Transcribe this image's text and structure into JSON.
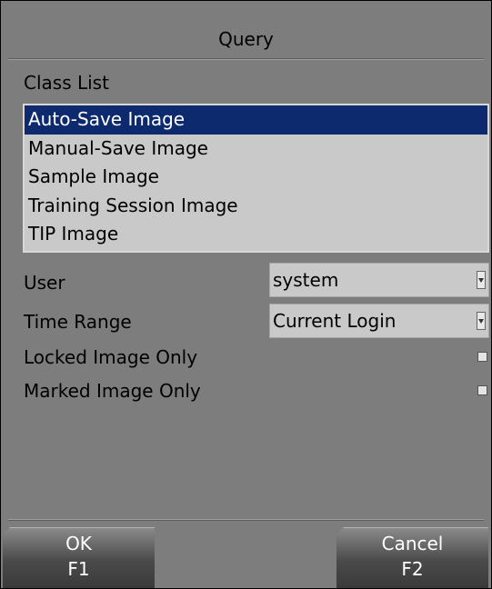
{
  "dialog": {
    "title": "Query"
  },
  "class_list": {
    "label": "Class List",
    "items": [
      {
        "label": "Auto-Save Image",
        "selected": true
      },
      {
        "label": "Manual-Save Image",
        "selected": false
      },
      {
        "label": "Sample Image",
        "selected": false
      },
      {
        "label": "Training Session Image",
        "selected": false
      },
      {
        "label": "TIP Image",
        "selected": false
      }
    ]
  },
  "user": {
    "label": "User",
    "value": "system"
  },
  "time_range": {
    "label": "Time Range",
    "value": "Current Login"
  },
  "locked_only": {
    "label": "Locked Image Only",
    "checked": false
  },
  "marked_only": {
    "label": "Marked Image Only",
    "checked": false
  },
  "buttons": {
    "ok": {
      "label": "OK",
      "key": "F1"
    },
    "cancel": {
      "label": "Cancel",
      "key": "F2"
    }
  },
  "colors": {
    "background": "#7d7d7d",
    "list_background": "#c9c9c9",
    "selection": "#0e2a6e"
  }
}
